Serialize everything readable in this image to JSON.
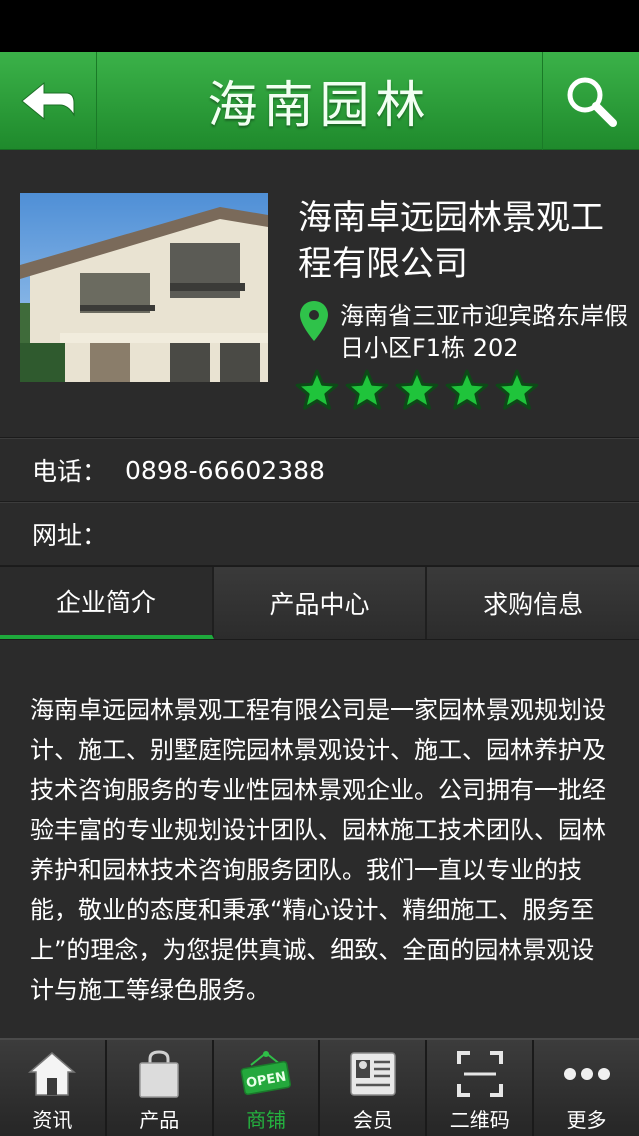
{
  "header": {
    "title": "海南园林"
  },
  "company": {
    "name": "海南卓远园林景观工程有限公司",
    "address": "海南省三亚市迎宾路东岸假日小区F1栋 202",
    "rating": 5,
    "star_color": "#1fc43b"
  },
  "contact": {
    "phone_label": "电话：",
    "phone_value": "0898-66602388",
    "web_label": "网址：",
    "web_value": ""
  },
  "tabs": [
    {
      "label": "企业简介",
      "active": true
    },
    {
      "label": "产品中心",
      "active": false
    },
    {
      "label": "求购信息",
      "active": false
    }
  ],
  "intro": "海南卓远园林景观工程有限公司是一家园林景观规划设计、施工、别墅庭院园林景观设计、施工、园林养护及技术咨询服务的专业性园林景观企业。公司拥有一批经验丰富的专业规划设计团队、园林施工技术团队、园林养护和园林技术咨询服务团队。我们一直以专业的技能，敬业的态度和秉承“精心设计、精细施工、服务至上”的理念，为您提供真诚、细致、全面的园林景观设计与施工等绿色服务。",
  "bottom_nav": [
    {
      "label": "资讯",
      "icon": "home-icon"
    },
    {
      "label": "产品",
      "icon": "shopping-bag-icon"
    },
    {
      "label": "商铺",
      "icon": "open-sign-icon",
      "active": true,
      "icon_text": "OPEN"
    },
    {
      "label": "会员",
      "icon": "member-card-icon"
    },
    {
      "label": "二维码",
      "icon": "qr-scan-icon"
    },
    {
      "label": "更多",
      "icon": "more-dots-icon"
    }
  ],
  "colors": {
    "accent": "#1ea93c",
    "header_green": "#2a9d38",
    "background": "#2b2b2b"
  }
}
